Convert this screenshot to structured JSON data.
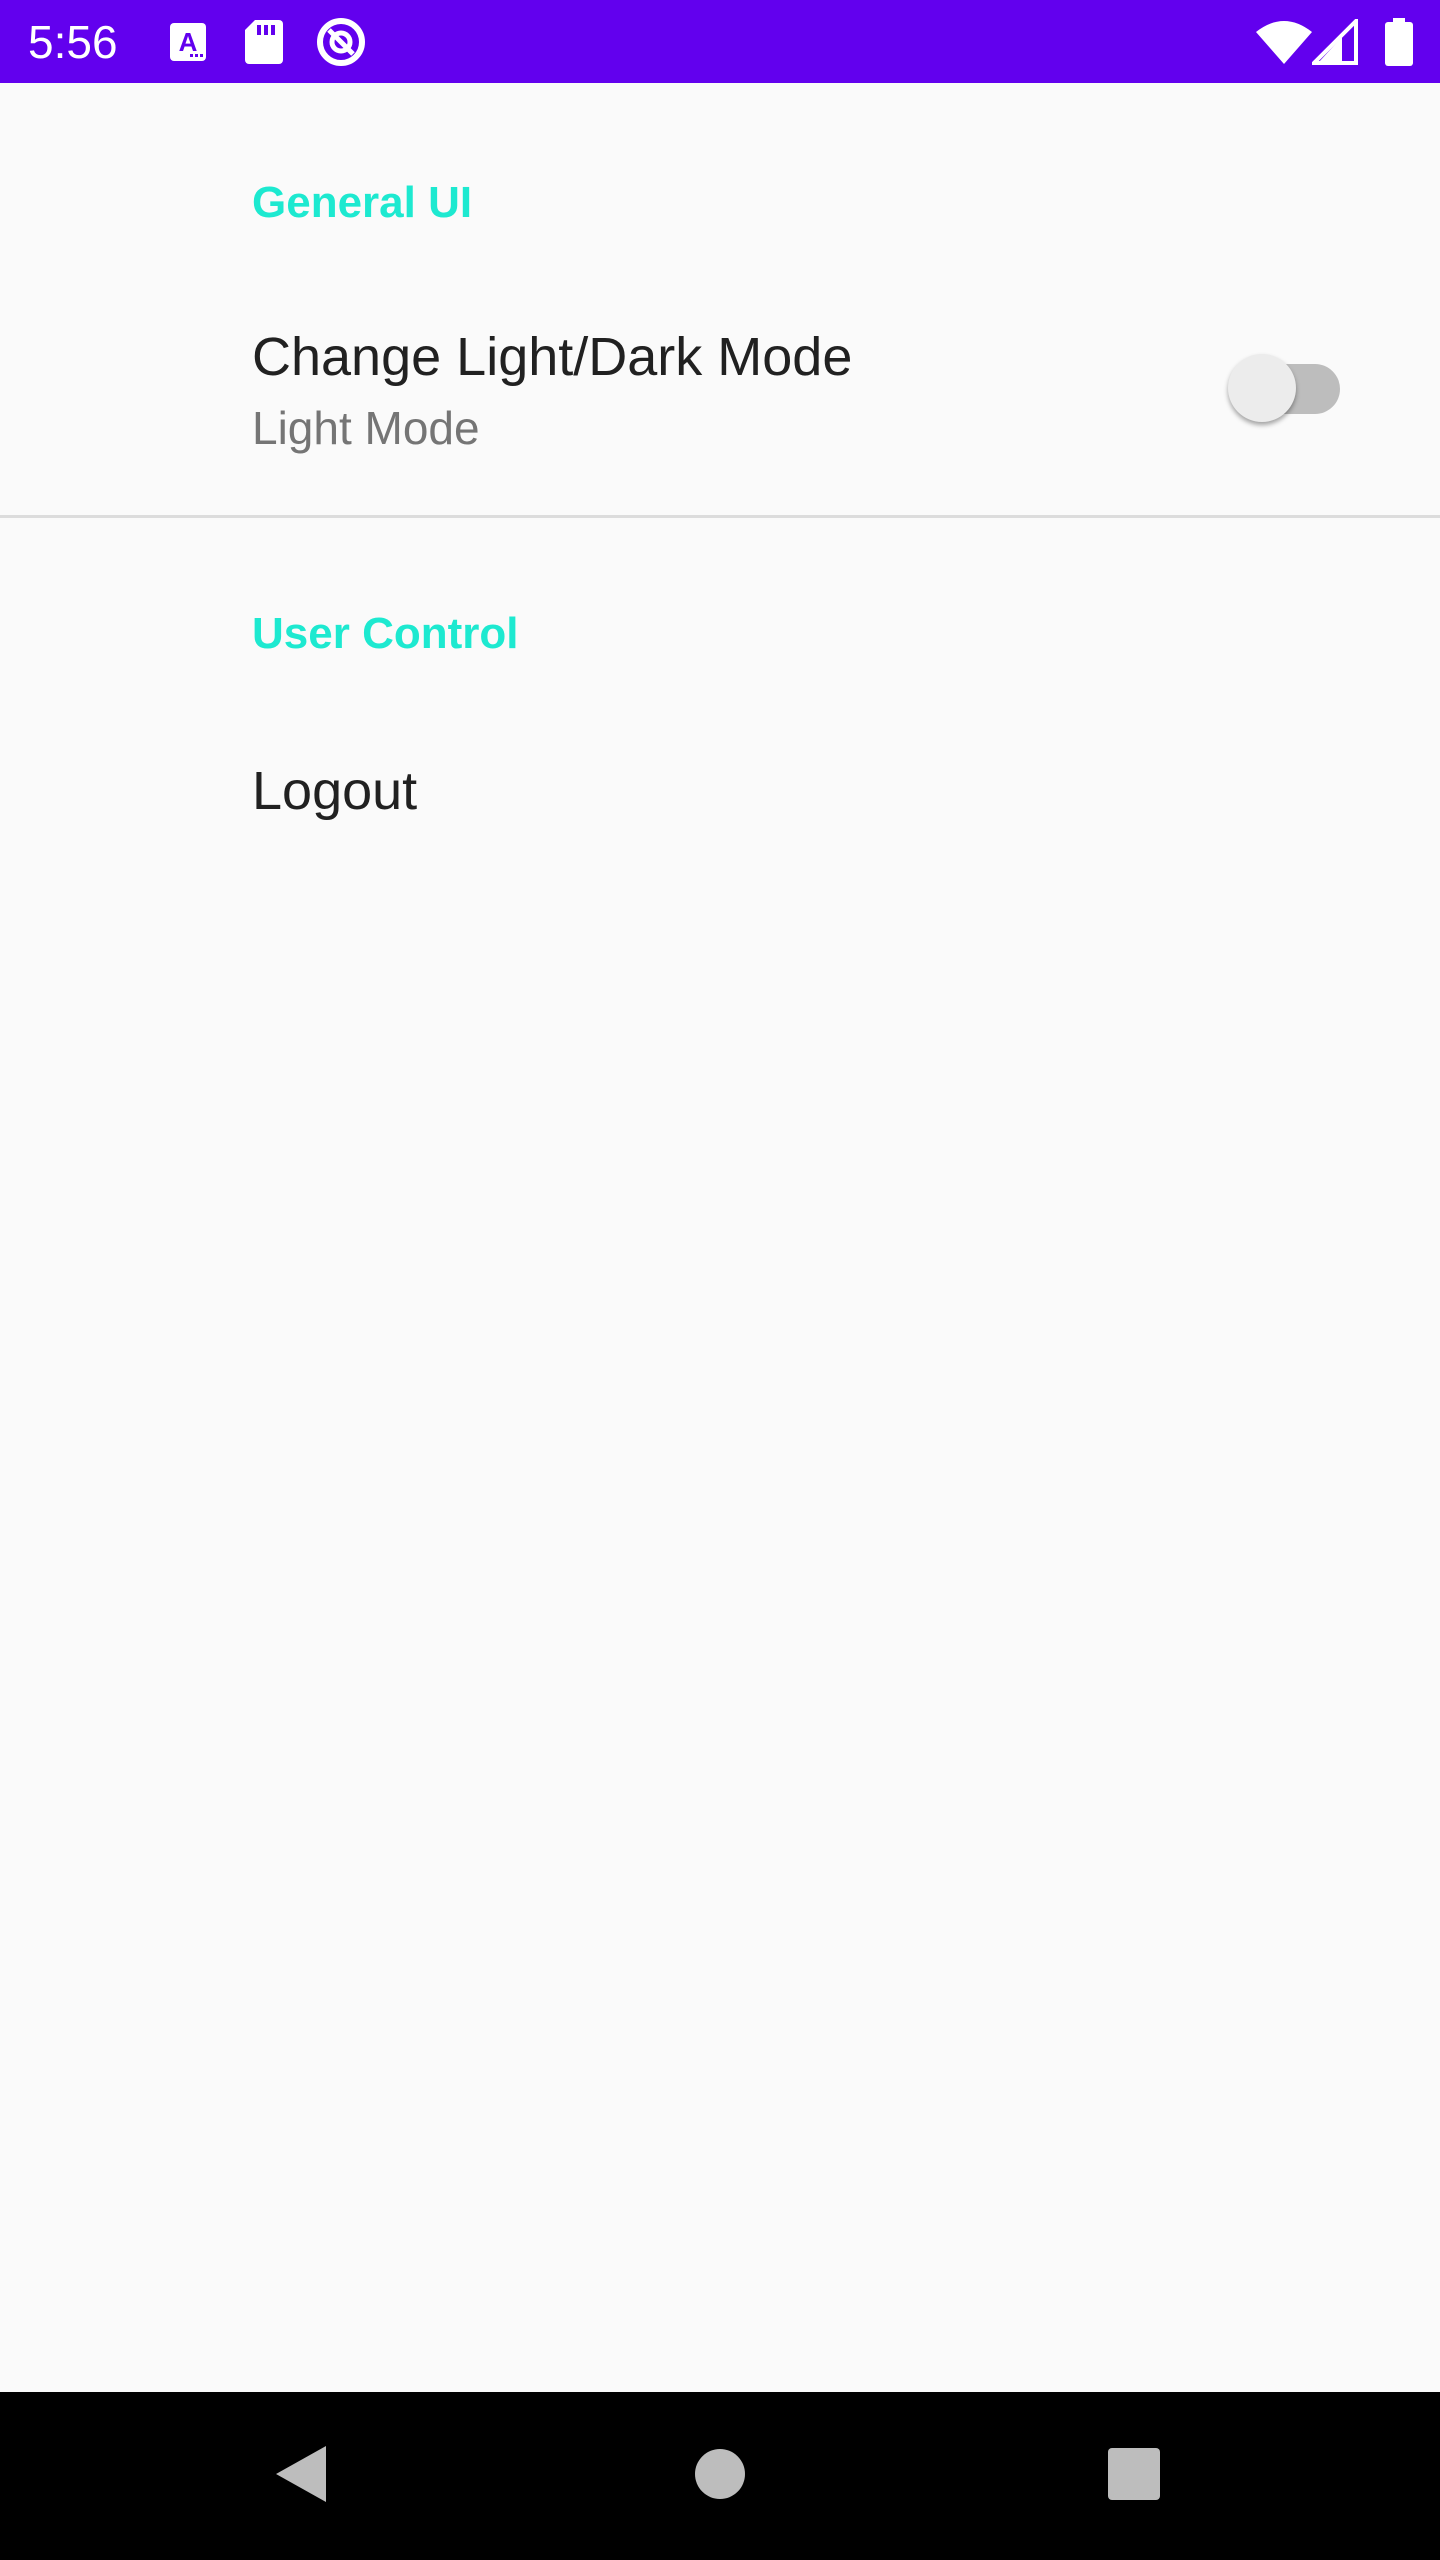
{
  "status_bar": {
    "time": "5:56",
    "background_color": "#6200ee",
    "left_icons": [
      "text-a-icon",
      "sd-card-icon",
      "sync-icon"
    ],
    "right_icons": [
      "wifi-icon",
      "cell-signal-icon",
      "battery-icon"
    ]
  },
  "accent_color": "#1de9d0",
  "sections": {
    "general": {
      "header": "General UI",
      "mode_pref": {
        "title": "Change Light/Dark Mode",
        "summary": "Light Mode",
        "switch_on": false
      }
    },
    "user_control": {
      "header": "User Control",
      "logout": {
        "title": "Logout"
      }
    }
  },
  "nav_bar": {
    "buttons": [
      "back-icon",
      "home-icon",
      "recents-icon"
    ]
  }
}
